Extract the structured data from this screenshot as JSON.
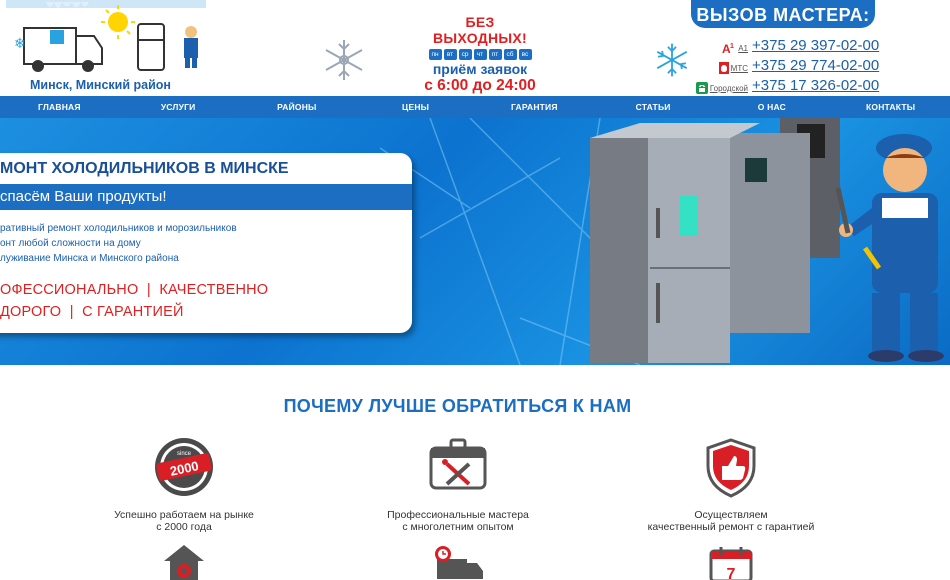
{
  "header": {
    "location": "Минск, Минский район",
    "hours_line1": "БЕЗ ВЫХОДНЫХ!",
    "days": [
      "пн",
      "вт",
      "ср",
      "чт",
      "пт",
      "сб",
      "вс"
    ],
    "hours_line2": "приём заявок",
    "hours_line3": "с 6:00 до 24:00",
    "call_label": "ВЫЗОВ МАСТЕРА:",
    "phones": [
      {
        "operator": "A1",
        "number": "+375 29 397-02-00"
      },
      {
        "operator": "МТС",
        "number": "+375 29 774-02-00"
      },
      {
        "operator": "Городской",
        "number": "+375 17 326-02-00"
      }
    ]
  },
  "nav": {
    "items": [
      "ГЛАВНАЯ",
      "УСЛУГИ",
      "РАЙОНЫ",
      "ЦЕНЫ",
      "ГАРАНТИЯ",
      "СТАТЬИ",
      "О НАС",
      "КОНТАКТЫ"
    ]
  },
  "hero": {
    "title": "МОНТ ХОЛОДИЛЬНИКОВ В МИНСКЕ",
    "subtitle": "спасём Ваши продукты!",
    "list": [
      "ративный ремонт холодильников и морозильников",
      "онт любой сложности на дому",
      "луживание Минска и Минского района"
    ],
    "red_line1": "ОФЕССИОНАЛЬНО  |  КАЧЕСТВЕННО",
    "red_line2": "ДОРОГО  |  С ГАРАНТИЕЙ"
  },
  "why": {
    "title": "ПОЧЕМУ ЛУЧШЕ ОБРАТИТЬСЯ К НАМ",
    "badge_since": "since",
    "badge_year": "2000",
    "calendar_number": "7",
    "features": [
      {
        "icon": "since-2000-badge-icon",
        "line1": "Успешно работаем на рынке",
        "line2": "с 2000 года"
      },
      {
        "icon": "toolbox-icon",
        "line1": "Профессиональные мастера",
        "line2": "с многолетним опытом"
      },
      {
        "icon": "shield-thumbs-up-icon",
        "line1": "Осуществляем",
        "line2": "качественный ремонт с гарантией"
      }
    ]
  },
  "colors": {
    "brand_blue": "#1b6ec2",
    "accent_red": "#e02020"
  }
}
